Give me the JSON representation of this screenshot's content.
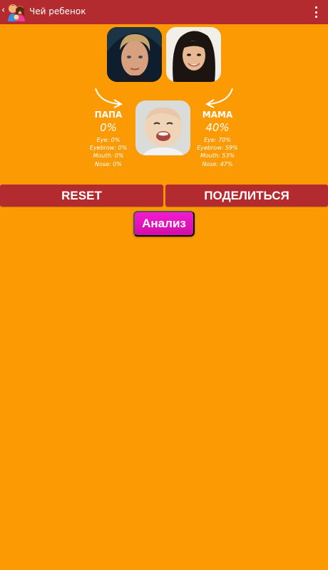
{
  "actionbar": {
    "title": "Чей ребенок",
    "back_icon": "chevron-left-icon",
    "app_icon": "family-icon",
    "menu_icon": "overflow-menu-icon"
  },
  "papa": {
    "name": "ПАПА",
    "percent": "0%",
    "stats": [
      "Eye: 0%",
      "Eyebrow: 0%",
      "Mouth: 0%",
      "Nose: 0%"
    ]
  },
  "mama": {
    "name": "МАМА",
    "percent": "40%",
    "stats": [
      "Eye: 70%",
      "Eyebrow: 59%",
      "Mouth: 53%",
      "Nose: 47%"
    ]
  },
  "buttons": {
    "reset": "RESET",
    "share": "ПОДЕЛИТЬСЯ",
    "analyze": "Анализ"
  },
  "colors": {
    "background": "#fb9a02",
    "bar": "#b32b2e",
    "analyze": "#e516c0"
  }
}
